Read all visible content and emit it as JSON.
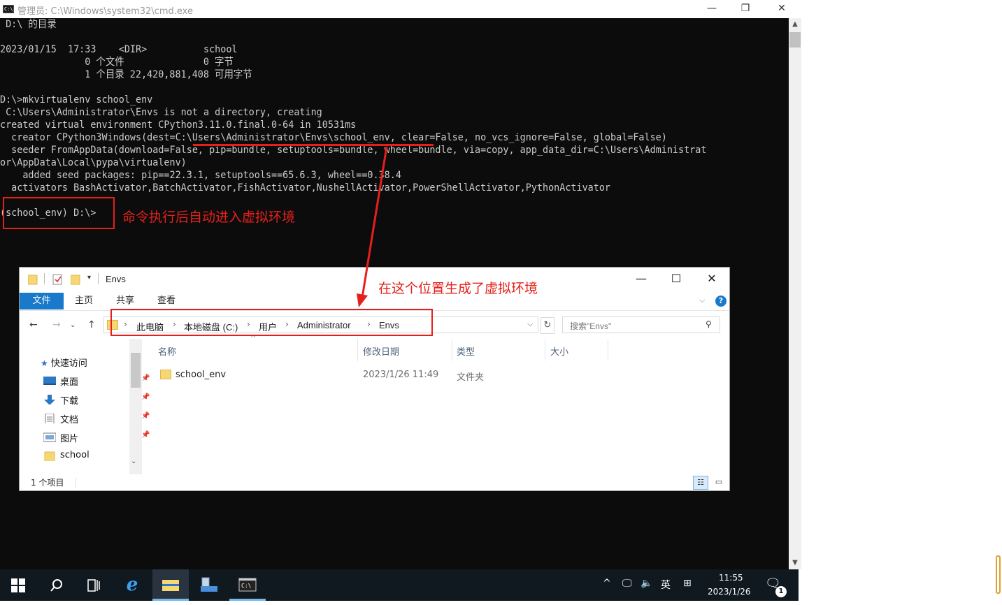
{
  "cmd": {
    "title": "管理员: C:\\Windows\\system32\\cmd.exe",
    "min_glyph": "—",
    "max_glyph": "❐",
    "close_glyph": "✕",
    "lines": [
      " D:\\ 的目录",
      "",
      "2023/01/15  17:33    <DIR>          school",
      "               0 个文件              0 字节",
      "               1 个目录 22,420,881,408 可用字节",
      "",
      "D:\\>mkvirtualenv school_env",
      " C:\\Users\\Administrator\\Envs is not a directory, creating",
      "created virtual environment CPython3.11.0.final.0-64 in 10531ms",
      "  creator CPython3Windows(dest=C:\\Users\\Administrator\\Envs\\school_env, clear=False, no_vcs_ignore=False, global=False)",
      "  seeder FromAppData(download=False, pip=bundle, setuptools=bundle, wheel=bundle, via=copy, app_data_dir=C:\\Users\\Administrat",
      "or\\AppData\\Local\\pypa\\virtualenv)",
      "    added seed packages: pip==22.3.1, setuptools==65.6.3, wheel==0.38.4",
      "  activators BashActivator,BatchActivator,FishActivator,NushellActivator,PowerShellActivator,PythonActivator",
      "",
      "(school_env) D:\\>"
    ]
  },
  "annotations": {
    "prompt_note": "命令执行后自动进入虚拟环境",
    "location_note": "在这个位置生成了虚拟环境",
    "color": "#e5201b"
  },
  "explorer": {
    "title": "Envs",
    "ribbon": {
      "file": "文件",
      "tabs": [
        "主页",
        "共享",
        "查看"
      ]
    },
    "nav": {
      "back": "←",
      "forward": "→",
      "up": "↑",
      "recent": "⌄"
    },
    "breadcrumb": [
      "此电脑",
      "本地磁盘 (C:)",
      "用户",
      "Administrator",
      "Envs"
    ],
    "search_placeholder": "搜索\"Envs\"",
    "sidebar": [
      {
        "label": "快速访问",
        "icon": "star-icon",
        "pinned": false
      },
      {
        "label": "桌面",
        "icon": "desktop-icon",
        "pinned": true
      },
      {
        "label": "下载",
        "icon": "download-icon",
        "pinned": true
      },
      {
        "label": "文档",
        "icon": "document-icon",
        "pinned": true
      },
      {
        "label": "图片",
        "icon": "pictures-icon",
        "pinned": true
      },
      {
        "label": "school",
        "icon": "folder-icon",
        "pinned": false
      }
    ],
    "columns": [
      "名称",
      "修改日期",
      "类型",
      "大小"
    ],
    "rows": [
      {
        "name": "school_env",
        "modified": "2023/1/26 11:49",
        "type": "文件夹",
        "size": ""
      }
    ],
    "status": "1 个项目"
  },
  "taskbar": {
    "clock_time": "11:55",
    "clock_date": "2023/1/26",
    "ime": "英",
    "ime_mode": "⊞",
    "notification_count": "1",
    "apps": [
      "start-button",
      "search-button",
      "task-view-button",
      "ie-button",
      "file-explorer-button",
      "server-manager-button",
      "cmd-button"
    ]
  }
}
